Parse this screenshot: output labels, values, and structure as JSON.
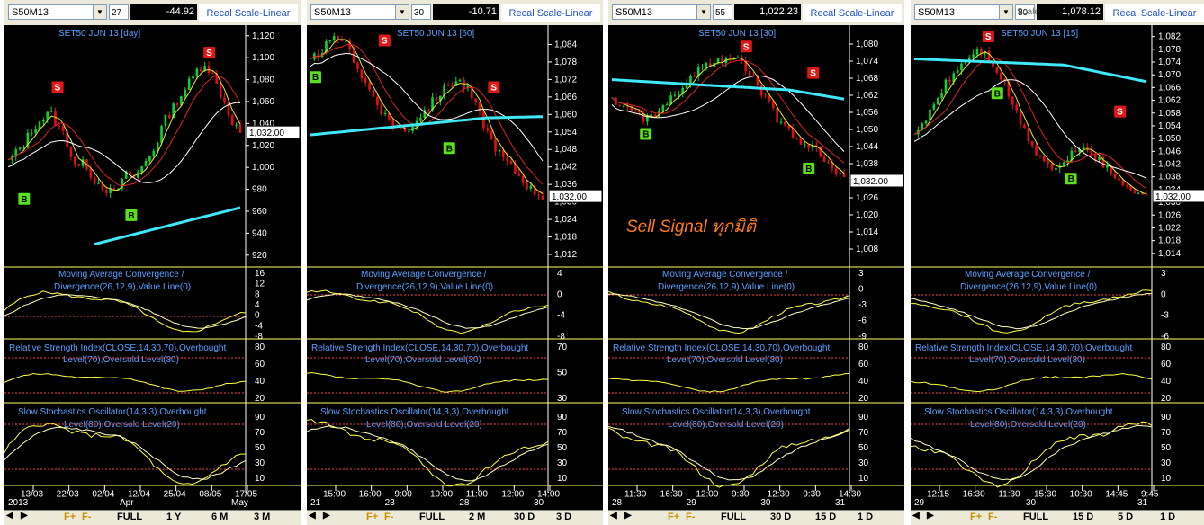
{
  "panes": [
    {
      "symbol": "S50M13",
      "mini": "27",
      "price_display": "-44.92",
      "recal_label": "Recal Scale-Linear",
      "scale_type": "",
      "title": "SET50 JUN 13   [day]",
      "last_price": "1,032.00",
      "price_ticks": [
        "1,120",
        "1,100",
        "1,080",
        "1,060",
        "1,040",
        "1,020",
        "1,000",
        "980",
        "960",
        "940",
        "920"
      ],
      "price_range": [
        910,
        1128
      ],
      "macd_title": [
        "Moving Average Convergence /",
        "Divergence(26,12,9),Value Line(0)"
      ],
      "macd_ticks": [
        "16",
        "12",
        "8",
        "4",
        "0",
        "-4",
        "-8"
      ],
      "rsi_title": [
        "Relative Strength Index(CLOSE,14,30,70),Overbought",
        "Level(70),Oversold Level(30)"
      ],
      "rsi_ticks": [
        "80",
        "60",
        "40",
        "20"
      ],
      "sto_title": [
        "Slow Stochastics Oscillator(14,3,3),Overbought",
        "Level(80),Oversold Level(20)"
      ],
      "sto_ticks": [
        "90",
        "70",
        "50",
        "30",
        "10"
      ],
      "time_labels": [
        "13/03",
        "22/03",
        "02/04",
        "12/04",
        "25/04",
        "08/05",
        "17/05"
      ],
      "date_labels": [
        "2013",
        "Apr",
        "May"
      ],
      "nav": [
        "F+",
        "F-",
        "FULL",
        "1 Y",
        "6 M",
        "3 M"
      ],
      "signals": [
        {
          "type": "S",
          "label": "S"
        },
        {
          "type": "S",
          "label": "S"
        },
        {
          "type": "B",
          "label": "B"
        },
        {
          "type": "B",
          "label": "B"
        }
      ],
      "chart_data": {
        "type": "line",
        "title": "SET50 JUN 13   [day]",
        "ylim": [
          910,
          1128
        ],
        "series": [
          {
            "name": "Close",
            "values": [
              1005,
              1012,
              1020,
              1030,
              1040,
              1045,
              1050,
              1038,
              1030,
              1010,
              1000,
              1005,
              990,
              985,
              980,
              975,
              985,
              995,
              990,
              1000,
              1010,
              1020,
              1040,
              1050,
              1060,
              1070,
              1080,
              1090,
              1095,
              1085,
              1070,
              1055,
              1040,
              1032
            ]
          }
        ]
      }
    },
    {
      "symbol": "S50M13",
      "mini": "30",
      "price_display": "-10.71",
      "recal_label": "Recal Scale-Linear",
      "scale_type": "",
      "title": "SET50 JUN 13   [60]",
      "last_price": "1,032.00",
      "price_ticks": [
        "1,084",
        "1,078",
        "1,072",
        "1,066",
        "1,060",
        "1,054",
        "1,048",
        "1,042",
        "1,036",
        "1,030",
        "1,024",
        "1,018",
        "1,012"
      ],
      "price_range": [
        1008,
        1090
      ],
      "macd_title": [
        "Moving Average Convergence /",
        "Divergence(26,12,9),Value Line(0)"
      ],
      "macd_ticks": [
        "4",
        "0",
        "-4",
        "-8"
      ],
      "rsi_title": [
        "Relative Strength Index(CLOSE,14,30,70),Overbought",
        "Level(70),Oversold Level(30)"
      ],
      "rsi_ticks": [
        "70",
        "50",
        "30"
      ],
      "sto_title": [
        "Slow Stochastics Oscillator(14,3,3),Overbought",
        "Level(80),Oversold Level(20)"
      ],
      "sto_ticks": [
        "90",
        "70",
        "50",
        "30",
        "10"
      ],
      "time_labels": [
        "15:00",
        "16:00",
        "9:00",
        "10:00",
        "11:00",
        "12:00",
        "14:00"
      ],
      "date_labels": [
        "21",
        "23",
        "28",
        "30"
      ],
      "nav": [
        "F+",
        "F-",
        "FULL",
        "2 M",
        "30 D",
        "3 D"
      ],
      "signals": [
        {
          "type": "S",
          "label": "S"
        },
        {
          "type": "S",
          "label": "S"
        },
        {
          "type": "B",
          "label": "B"
        },
        {
          "type": "B",
          "label": "B"
        }
      ],
      "chart_data": {
        "type": "line",
        "title": "SET50 JUN 13   [60]",
        "ylim": [
          1008,
          1090
        ],
        "series": [
          {
            "name": "Close",
            "values": [
              1078,
              1082,
              1085,
              1086,
              1080,
              1072,
              1066,
              1060,
              1056,
              1054,
              1058,
              1062,
              1066,
              1070,
              1072,
              1068,
              1060,
              1052,
              1046,
              1042,
              1038,
              1034,
              1032
            ]
          }
        ]
      }
    },
    {
      "symbol": "S50M13",
      "mini": "55",
      "price_display": "1,022.23",
      "recal_label": "Recal Scale-Linear",
      "scale_type": "",
      "title": "SET50 JUN 13   [30]",
      "last_price": "1,032.00",
      "price_ticks": [
        "1,080",
        "1,074",
        "1,068",
        "1,062",
        "1,056",
        "1,050",
        "1,044",
        "1,038",
        "1,032",
        "1,026",
        "1,020",
        "1,014",
        "1,008"
      ],
      "price_range": [
        1002,
        1086
      ],
      "macd_title": [
        "Moving Average Convergence /",
        "Divergence(26,12,9),Value Line(0)"
      ],
      "macd_ticks": [
        "3",
        "0",
        "-3",
        "-6",
        "-9"
      ],
      "rsi_title": [
        "Relative Strength Index(CLOSE,14,30,70),Overbought",
        "Level(70),Oversold Level(30)"
      ],
      "rsi_ticks": [
        "80",
        "60",
        "40",
        "20"
      ],
      "sto_title": [
        "Slow Stochastics Oscillator(14,3,3),Overbought",
        "Level(80),Oversold Level(20)"
      ],
      "sto_ticks": [
        "90",
        "70",
        "50",
        "30",
        "10"
      ],
      "time_labels": [
        "11:30",
        "16:30",
        "12:00",
        "9:30",
        "12:30",
        "9:30",
        "14:30"
      ],
      "date_labels": [
        "28",
        "29",
        "30",
        "31"
      ],
      "nav": [
        "F+",
        "F-",
        "FULL",
        "30 D",
        "15 D",
        "1 D"
      ],
      "annotation": "Sell Signal ทุกมิติ",
      "signals": [
        {
          "type": "S",
          "label": "S"
        },
        {
          "type": "S",
          "label": "S"
        },
        {
          "type": "B",
          "label": "B"
        },
        {
          "type": "B",
          "label": "B"
        }
      ],
      "chart_data": {
        "type": "line",
        "title": "SET50 JUN 13   [30]",
        "ylim": [
          1002,
          1086
        ],
        "series": [
          {
            "name": "Close",
            "values": [
              1060,
              1058,
              1056,
              1054,
              1055,
              1058,
              1062,
              1066,
              1070,
              1072,
              1074,
              1076,
              1074,
              1070,
              1064,
              1058,
              1052,
              1048,
              1046,
              1044,
              1040,
              1036,
              1032
            ]
          }
        ]
      }
    },
    {
      "symbol": "S50M13",
      "mini": "80",
      "price_display": "1,078.12",
      "recal_label": "Recal Scale-Linear",
      "scale_type": "Scale Type",
      "title": "SET50 JUN 13   [15]",
      "last_price": "1,032.00",
      "price_ticks": [
        "1,082",
        "1,078",
        "1,074",
        "1,070",
        "1,066",
        "1,062",
        "1,058",
        "1,054",
        "1,050",
        "1,046",
        "1,042",
        "1,038",
        "1,034",
        "1,030",
        "1,026",
        "1,022",
        "1,018",
        "1,014"
      ],
      "price_range": [
        1010,
        1085
      ],
      "macd_title": [
        "Moving Average Convergence /",
        "Divergence(26,12,9),Value Line(0)"
      ],
      "macd_ticks": [
        "3",
        "0",
        "-3",
        "-6"
      ],
      "rsi_title": [
        "Relative Strength Index(CLOSE,14,30,70),Overbought",
        "Level(70),Oversold Level(30)"
      ],
      "rsi_ticks": [
        "80",
        "60",
        "40",
        "20"
      ],
      "sto_title": [
        "Slow Stochastics Oscillator(14,3,3),Overbought",
        "Level(80),Oversold Level(20)"
      ],
      "sto_ticks": [
        "90",
        "70",
        "50",
        "30",
        "10"
      ],
      "time_labels": [
        "12:15",
        "16:30",
        "11:30",
        "15:30",
        "10:30",
        "14:45",
        "9:45"
      ],
      "date_labels": [
        "29",
        "30",
        "31"
      ],
      "nav": [
        "F+",
        "F-",
        "FULL",
        "15 D",
        "5 D",
        "1 D"
      ],
      "signals": [
        {
          "type": "S",
          "label": "S"
        },
        {
          "type": "S",
          "label": "S"
        },
        {
          "type": "B",
          "label": "B"
        },
        {
          "type": "B",
          "label": "B"
        }
      ],
      "chart_data": {
        "type": "line",
        "title": "SET50 JUN 13   [15]",
        "ylim": [
          1010,
          1085
        ],
        "series": [
          {
            "name": "Close",
            "values": [
              1050,
              1056,
              1062,
              1068,
              1072,
              1076,
              1078,
              1074,
              1068,
              1060,
              1052,
              1046,
              1042,
              1040,
              1044,
              1048,
              1046,
              1042,
              1038,
              1036,
              1034,
              1032
            ]
          }
        ]
      }
    }
  ],
  "colors": {
    "bull": "#10d030",
    "bear": "#e01010",
    "ma_fast": "#e8e830",
    "ma_mid": "#e02020",
    "ma_slow": "#ffffff",
    "ma_long": "#40e8f8",
    "signal_s": "#e01818",
    "signal_b": "#58e018",
    "title": "#5aa0ff",
    "annotation": "#ff7a18"
  }
}
